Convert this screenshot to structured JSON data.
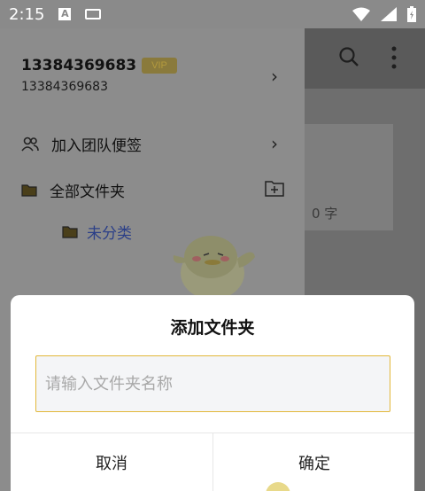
{
  "status_bar": {
    "time": "2:15",
    "notification_letter": "A"
  },
  "drawer": {
    "phone_title": "13384369683",
    "vip_label": "VIP",
    "phone_sub": "13384369683",
    "join_team_label": "加入团队便签",
    "all_folders_label": "全部文件夹",
    "uncategorized_label": "未分类"
  },
  "main": {
    "word_count": "0 字"
  },
  "dialog": {
    "title": "添加文件夹",
    "input_placeholder": "请输入文件夹名称",
    "input_value": "",
    "cancel_label": "取消",
    "confirm_label": "确定"
  },
  "colors": {
    "accent_border": "#e2b83a",
    "selected_folder_text": "#2b3f88"
  }
}
